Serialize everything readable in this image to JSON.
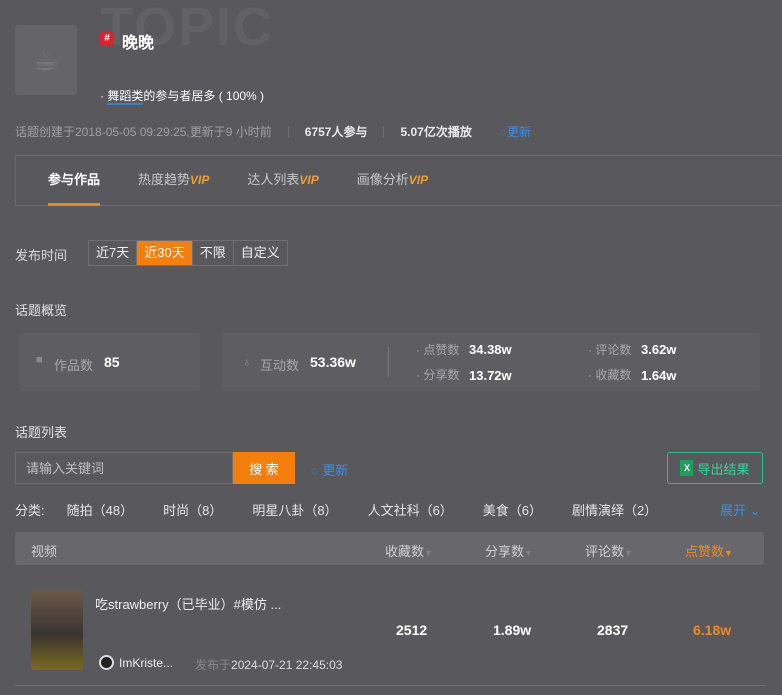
{
  "header": {
    "watermark": "TOPIC",
    "tag_icon": "#",
    "title": "晚晚",
    "summary_prefix": "· ",
    "summary_highlight": "舞蹈类",
    "summary_rest": "的参与者居多 ( 100% )",
    "created": "话题创建于2018-05-05 09:29:25,更新于9 小时前",
    "participants": "6757人参与",
    "plays": "5.07亿次播放",
    "refresh": "更新"
  },
  "tabs": [
    {
      "label": "参与作品",
      "vip": ""
    },
    {
      "label": "热度趋势",
      "vip": "VIP"
    },
    {
      "label": "达人列表",
      "vip": "VIP"
    },
    {
      "label": "画像分析",
      "vip": "VIP"
    }
  ],
  "time_filter": {
    "label": "发布时间",
    "options": [
      "近7天",
      "近30天",
      "不限",
      "自定义"
    ],
    "selected": "近30天"
  },
  "overview": {
    "title": "话题概览",
    "works_label": "作品数",
    "works": "85",
    "interact_label": "互动数",
    "interact": "53.36w",
    "likes_label": "点赞数",
    "likes": "34.38w",
    "comments_label": "评论数",
    "comments": "3.62w",
    "shares_label": "分享数",
    "shares": "13.72w",
    "favs_label": "收藏数",
    "favs": "1.64w"
  },
  "list": {
    "title": "话题列表",
    "placeholder": "请输入关键词",
    "search": "搜 索",
    "refresh": "更新",
    "export": "导出结果",
    "cat_label": "分类:",
    "categories": [
      "随拍（48）",
      "时尚（8）",
      "明星八卦（8）",
      "人文社科（6）",
      "美食（6）",
      "剧情演绎（2）"
    ],
    "expand": "展开",
    "columns": {
      "video": "视频",
      "favs": "收藏数",
      "shares": "分享数",
      "comments": "评论数",
      "likes": "点赞数"
    },
    "rows": [
      {
        "title": "吃strawberry（已毕业）#模仿 ...",
        "author": "ImKriste...",
        "published_prefix": "发布于",
        "published": "2024-07-21 22:45:03",
        "favs": "2512",
        "shares": "1.89w",
        "comments": "2837",
        "likes": "6.18w"
      }
    ]
  },
  "colors": {
    "accent": "#f57f0c",
    "link": "#3d8fe6",
    "export": "#3cd49a"
  }
}
